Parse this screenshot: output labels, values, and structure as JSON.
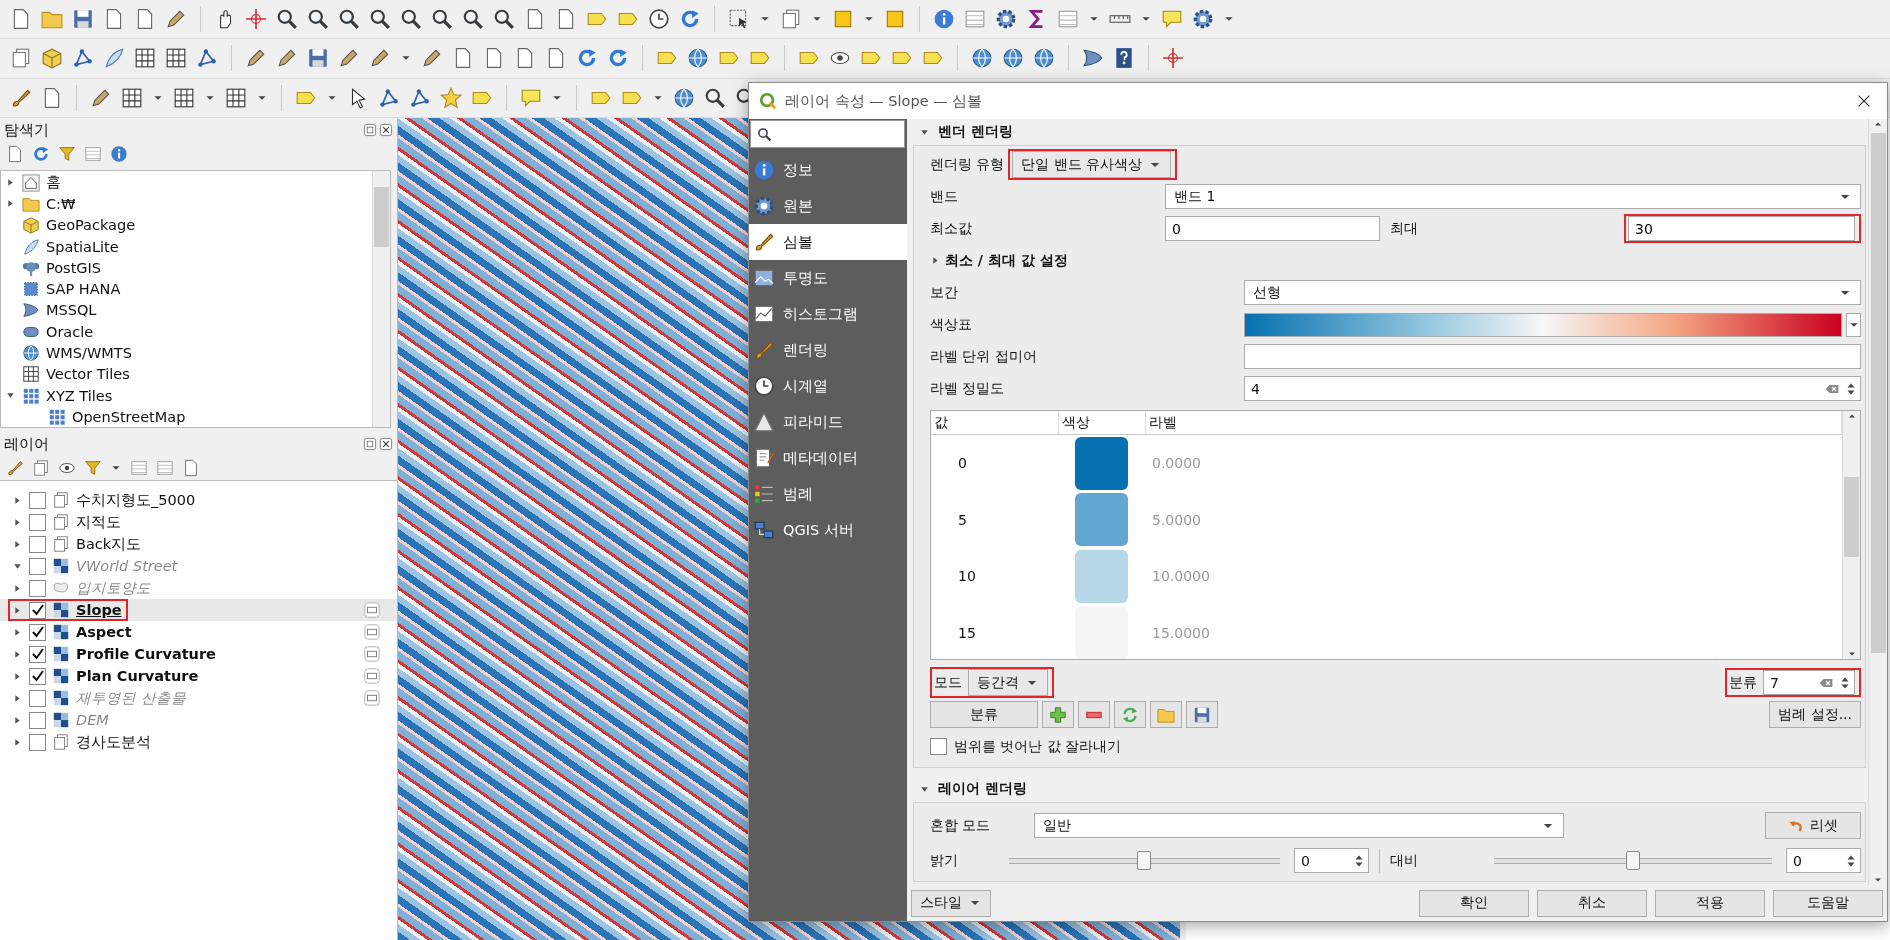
{
  "browser": {
    "title": "탐색기",
    "items": [
      {
        "label": "홈",
        "kind": "home",
        "expandable": true,
        "expanded": false
      },
      {
        "label": "C:₩",
        "kind": "folder",
        "expandable": true,
        "expanded": false
      },
      {
        "label": "GeoPackage",
        "kind": "package",
        "expandable": false
      },
      {
        "label": "SpatiaLite",
        "kind": "feather",
        "expandable": false
      },
      {
        "label": "PostGIS",
        "kind": "elephant",
        "expandable": false
      },
      {
        "label": "SAP HANA",
        "kind": "hana",
        "expandable": false
      },
      {
        "label": "MSSQL",
        "kind": "mssql",
        "expandable": false
      },
      {
        "label": "Oracle",
        "kind": "oracle",
        "expandable": false
      },
      {
        "label": "WMS/WMTS",
        "kind": "globe",
        "expandable": false
      },
      {
        "label": "Vector Tiles",
        "kind": "grid",
        "expandable": false
      },
      {
        "label": "XYZ Tiles",
        "kind": "tiles",
        "expandable": true,
        "expanded": true,
        "children": [
          {
            "label": "OpenStreetMap",
            "kind": "tiles",
            "expandable": false
          }
        ]
      }
    ]
  },
  "layers": {
    "title": "레이어",
    "items": [
      {
        "name": "수치지형도_5000",
        "kind": "group",
        "checked": false,
        "expanded": false,
        "dimmed": false,
        "selected": false,
        "highlighted": false,
        "indicator": false
      },
      {
        "name": "지적도",
        "kind": "group",
        "checked": false,
        "expanded": false,
        "dimmed": false,
        "selected": false,
        "highlighted": false,
        "indicator": false
      },
      {
        "name": "Back지도",
        "kind": "group",
        "checked": false,
        "expanded": false,
        "dimmed": false,
        "selected": false,
        "highlighted": false,
        "indicator": false
      },
      {
        "name": "VWorld Street",
        "kind": "raster",
        "checked": false,
        "expanded": true,
        "dimmed": true,
        "selected": false,
        "highlighted": false,
        "indicator": false
      },
      {
        "name": "입지토양도",
        "kind": "polygon",
        "checked": false,
        "expanded": false,
        "dimmed": true,
        "selected": false,
        "highlighted": false,
        "indicator": false
      },
      {
        "name": "Slope",
        "kind": "raster",
        "checked": true,
        "expanded": false,
        "dimmed": false,
        "selected": true,
        "highlighted": true,
        "indicator": true
      },
      {
        "name": "Aspect",
        "kind": "raster",
        "checked": true,
        "expanded": false,
        "dimmed": false,
        "selected": false,
        "highlighted": false,
        "indicator": true
      },
      {
        "name": "Profile Curvature",
        "kind": "raster",
        "checked": true,
        "expanded": false,
        "dimmed": false,
        "selected": false,
        "highlighted": false,
        "indicator": true
      },
      {
        "name": "Plan Curvature",
        "kind": "raster",
        "checked": true,
        "expanded": false,
        "dimmed": false,
        "selected": false,
        "highlighted": false,
        "indicator": true
      },
      {
        "name": "재투영된 산출물",
        "kind": "raster",
        "checked": false,
        "expanded": false,
        "dimmed": true,
        "selected": false,
        "highlighted": false,
        "indicator": true
      },
      {
        "name": "DEM",
        "kind": "raster",
        "checked": false,
        "expanded": false,
        "dimmed": true,
        "selected": false,
        "highlighted": false,
        "indicator": false
      },
      {
        "name": "경사도분석",
        "kind": "group",
        "checked": false,
        "expanded": false,
        "dimmed": false,
        "selected": false,
        "highlighted": false,
        "indicator": false
      }
    ]
  },
  "dialog": {
    "title": "레이어 속성 — Slope — 심볼",
    "sidebar": [
      {
        "label": "정보",
        "kind": "info",
        "selected": false
      },
      {
        "label": "원본",
        "kind": "source",
        "selected": false
      },
      {
        "label": "심볼",
        "kind": "symbology",
        "selected": true
      },
      {
        "label": "투명도",
        "kind": "transparency",
        "selected": false
      },
      {
        "label": "히스토그램",
        "kind": "histogram",
        "selected": false
      },
      {
        "label": "렌더링",
        "kind": "rendering",
        "selected": false
      },
      {
        "label": "시계열",
        "kind": "temporal",
        "selected": false
      },
      {
        "label": "피라미드",
        "kind": "pyramid",
        "selected": false
      },
      {
        "label": "메타데이터",
        "kind": "metadata",
        "selected": false
      },
      {
        "label": "범례",
        "kind": "legend",
        "selected": false
      },
      {
        "label": "QGIS 서버",
        "kind": "server",
        "selected": false
      }
    ],
    "band_rendering": {
      "heading": "벤더 렌더링",
      "expanded": true,
      "render_type": {
        "label": "렌더링 유형",
        "value": "단일 밴드 유사색상",
        "highlighted": true
      },
      "band": {
        "label": "밴드",
        "value": "밴드 1"
      },
      "min": {
        "label": "최소값",
        "value": "0"
      },
      "max": {
        "label": "최대",
        "value": "30",
        "highlighted": true
      },
      "minmax_section": {
        "heading": "최소 / 최대 값 설정",
        "expanded": false
      },
      "interpolation": {
        "label": "보간",
        "value": "선형"
      },
      "color_ramp": {
        "label": "색상표"
      },
      "label_suffix": {
        "label": "라벨 단위 접미어"
      },
      "label_precision": {
        "label": "라벨 정밀도",
        "value": "4"
      },
      "table": {
        "columns": [
          "값",
          "색상",
          "라벨"
        ],
        "rows": [
          {
            "value": "0",
            "color": "#0571b0",
            "label": "0.0000"
          },
          {
            "value": "5",
            "color": "#62a7d1",
            "label": "5.0000"
          },
          {
            "value": "10",
            "color": "#b5d7e8",
            "label": "10.0000"
          },
          {
            "value": "15",
            "color": "#f5f5f5",
            "label": "15.0000"
          }
        ]
      },
      "mode": {
        "label": "모드",
        "value": "등간격",
        "highlighted": true
      },
      "classes": {
        "label": "분류",
        "value": "7",
        "highlighted": true
      },
      "classify_button": "분류",
      "legend_settings_button": "범례 설정...",
      "clip": {
        "label": "범위를 벗어난 값 잘라내기",
        "checked": false
      }
    },
    "layer_rendering": {
      "heading": "레이어 렌더링",
      "expanded": true,
      "blend": {
        "label": "혼합 모드",
        "value": "일반"
      },
      "reset_button": "리셋",
      "brightness": {
        "label": "밝기",
        "value": "0",
        "level": 0.5
      },
      "contrast": {
        "label": "대비",
        "value": "0",
        "level": 0.5
      }
    },
    "footer": {
      "style_button": "스타일",
      "buttons": [
        "확인",
        "취소",
        "적용",
        "도움말"
      ]
    }
  }
}
